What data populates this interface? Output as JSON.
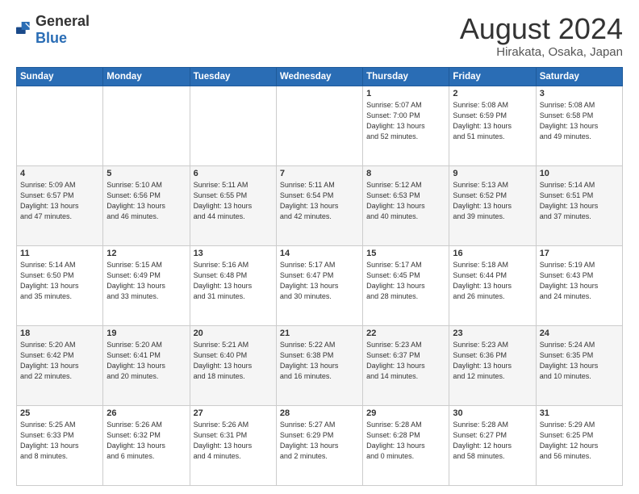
{
  "logo": {
    "general": "General",
    "blue": "Blue"
  },
  "title": "August 2024",
  "location": "Hirakata, Osaka, Japan",
  "weekdays": [
    "Sunday",
    "Monday",
    "Tuesday",
    "Wednesday",
    "Thursday",
    "Friday",
    "Saturday"
  ],
  "weeks": [
    [
      {
        "day": "",
        "info": ""
      },
      {
        "day": "",
        "info": ""
      },
      {
        "day": "",
        "info": ""
      },
      {
        "day": "",
        "info": ""
      },
      {
        "day": "1",
        "info": "Sunrise: 5:07 AM\nSunset: 7:00 PM\nDaylight: 13 hours\nand 52 minutes."
      },
      {
        "day": "2",
        "info": "Sunrise: 5:08 AM\nSunset: 6:59 PM\nDaylight: 13 hours\nand 51 minutes."
      },
      {
        "day": "3",
        "info": "Sunrise: 5:08 AM\nSunset: 6:58 PM\nDaylight: 13 hours\nand 49 minutes."
      }
    ],
    [
      {
        "day": "4",
        "info": "Sunrise: 5:09 AM\nSunset: 6:57 PM\nDaylight: 13 hours\nand 47 minutes."
      },
      {
        "day": "5",
        "info": "Sunrise: 5:10 AM\nSunset: 6:56 PM\nDaylight: 13 hours\nand 46 minutes."
      },
      {
        "day": "6",
        "info": "Sunrise: 5:11 AM\nSunset: 6:55 PM\nDaylight: 13 hours\nand 44 minutes."
      },
      {
        "day": "7",
        "info": "Sunrise: 5:11 AM\nSunset: 6:54 PM\nDaylight: 13 hours\nand 42 minutes."
      },
      {
        "day": "8",
        "info": "Sunrise: 5:12 AM\nSunset: 6:53 PM\nDaylight: 13 hours\nand 40 minutes."
      },
      {
        "day": "9",
        "info": "Sunrise: 5:13 AM\nSunset: 6:52 PM\nDaylight: 13 hours\nand 39 minutes."
      },
      {
        "day": "10",
        "info": "Sunrise: 5:14 AM\nSunset: 6:51 PM\nDaylight: 13 hours\nand 37 minutes."
      }
    ],
    [
      {
        "day": "11",
        "info": "Sunrise: 5:14 AM\nSunset: 6:50 PM\nDaylight: 13 hours\nand 35 minutes."
      },
      {
        "day": "12",
        "info": "Sunrise: 5:15 AM\nSunset: 6:49 PM\nDaylight: 13 hours\nand 33 minutes."
      },
      {
        "day": "13",
        "info": "Sunrise: 5:16 AM\nSunset: 6:48 PM\nDaylight: 13 hours\nand 31 minutes."
      },
      {
        "day": "14",
        "info": "Sunrise: 5:17 AM\nSunset: 6:47 PM\nDaylight: 13 hours\nand 30 minutes."
      },
      {
        "day": "15",
        "info": "Sunrise: 5:17 AM\nSunset: 6:45 PM\nDaylight: 13 hours\nand 28 minutes."
      },
      {
        "day": "16",
        "info": "Sunrise: 5:18 AM\nSunset: 6:44 PM\nDaylight: 13 hours\nand 26 minutes."
      },
      {
        "day": "17",
        "info": "Sunrise: 5:19 AM\nSunset: 6:43 PM\nDaylight: 13 hours\nand 24 minutes."
      }
    ],
    [
      {
        "day": "18",
        "info": "Sunrise: 5:20 AM\nSunset: 6:42 PM\nDaylight: 13 hours\nand 22 minutes."
      },
      {
        "day": "19",
        "info": "Sunrise: 5:20 AM\nSunset: 6:41 PM\nDaylight: 13 hours\nand 20 minutes."
      },
      {
        "day": "20",
        "info": "Sunrise: 5:21 AM\nSunset: 6:40 PM\nDaylight: 13 hours\nand 18 minutes."
      },
      {
        "day": "21",
        "info": "Sunrise: 5:22 AM\nSunset: 6:38 PM\nDaylight: 13 hours\nand 16 minutes."
      },
      {
        "day": "22",
        "info": "Sunrise: 5:23 AM\nSunset: 6:37 PM\nDaylight: 13 hours\nand 14 minutes."
      },
      {
        "day": "23",
        "info": "Sunrise: 5:23 AM\nSunset: 6:36 PM\nDaylight: 13 hours\nand 12 minutes."
      },
      {
        "day": "24",
        "info": "Sunrise: 5:24 AM\nSunset: 6:35 PM\nDaylight: 13 hours\nand 10 minutes."
      }
    ],
    [
      {
        "day": "25",
        "info": "Sunrise: 5:25 AM\nSunset: 6:33 PM\nDaylight: 13 hours\nand 8 minutes."
      },
      {
        "day": "26",
        "info": "Sunrise: 5:26 AM\nSunset: 6:32 PM\nDaylight: 13 hours\nand 6 minutes."
      },
      {
        "day": "27",
        "info": "Sunrise: 5:26 AM\nSunset: 6:31 PM\nDaylight: 13 hours\nand 4 minutes."
      },
      {
        "day": "28",
        "info": "Sunrise: 5:27 AM\nSunset: 6:29 PM\nDaylight: 13 hours\nand 2 minutes."
      },
      {
        "day": "29",
        "info": "Sunrise: 5:28 AM\nSunset: 6:28 PM\nDaylight: 13 hours\nand 0 minutes."
      },
      {
        "day": "30",
        "info": "Sunrise: 5:28 AM\nSunset: 6:27 PM\nDaylight: 12 hours\nand 58 minutes."
      },
      {
        "day": "31",
        "info": "Sunrise: 5:29 AM\nSunset: 6:25 PM\nDaylight: 12 hours\nand 56 minutes."
      }
    ]
  ]
}
